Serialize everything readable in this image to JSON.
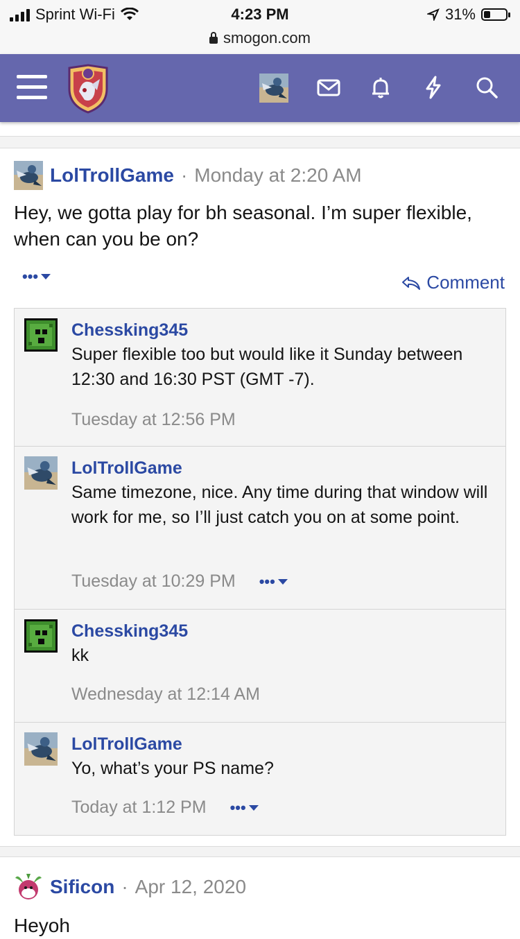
{
  "status_bar": {
    "carrier": "Sprint Wi-Fi",
    "time": "4:23 PM",
    "battery": "31%",
    "url": "smogon.com"
  },
  "nav": {
    "icons": [
      "menu-icon",
      "site-logo",
      "user-avatar",
      "mail-icon",
      "bell-icon",
      "bolt-icon",
      "search-icon"
    ]
  },
  "post": {
    "author": "LolTrollGame",
    "separator": "·",
    "time": "Monday at 2:20 AM",
    "body": "Hey, we gotta play for bh seasonal. I’m super flexible, when can you be on?",
    "more_label": "•••",
    "comment_label": "Comment"
  },
  "comments": [
    {
      "author": "Chessking345",
      "text": "Super flexible too but would like it Sunday between 12:30 and 16:30 PST (GMT -7).",
      "time": "Tuesday at 12:56 PM",
      "more": ""
    },
    {
      "author": "LolTrollGame",
      "text": "Same timezone, nice. Any time during that window will work for me, so I’ll just catch you on at some point.",
      "time": "Tuesday at 10:29 PM",
      "more": "•••"
    },
    {
      "author": "Chessking345",
      "text": "kk",
      "time": "Wednesday at 12:14 AM",
      "more": ""
    },
    {
      "author": "LolTrollGame",
      "text": "Yo, what’s your PS name?",
      "time": "Today at 1:12 PM",
      "more": "•••"
    }
  ],
  "post2": {
    "author": "Sificon",
    "separator": "·",
    "time": "Apr 12, 2020",
    "body": "Heyoh"
  },
  "colors": {
    "nav_bg": "#6567ad",
    "link": "#2b49a3",
    "muted": "#8a8a8a"
  }
}
